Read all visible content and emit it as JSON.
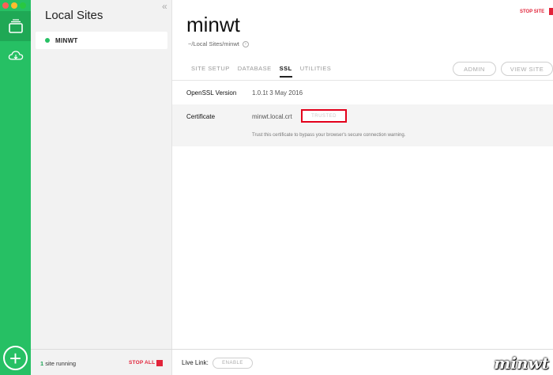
{
  "window": {
    "traffic_colors": [
      "#ff5f57",
      "#febc2e",
      "#28c840"
    ]
  },
  "rail": {
    "icons": [
      "sites-icon",
      "cloud-icon",
      "plus-icon"
    ],
    "add_label": "+"
  },
  "sites_panel": {
    "collapse_glyph": "«",
    "title": "Local Sites",
    "items": [
      {
        "name": "MINWT",
        "status_color": "#26c064"
      }
    ],
    "footer": {
      "running_count": "1",
      "running_text": " site running",
      "stop_all": "STOP ALL"
    }
  },
  "main": {
    "stop_site": "STOP SITE",
    "site_title": "minwt",
    "site_path": "~/Local Sites/minwt",
    "tabs": [
      {
        "label": "SITE SETUP"
      },
      {
        "label": "DATABASE"
      },
      {
        "label": "SSL"
      },
      {
        "label": "UTILITIES"
      }
    ],
    "active_tab": "SSL",
    "buttons": {
      "admin": "ADMIN",
      "view_site": "VIEW SITE"
    },
    "ssl": {
      "openssl_label": "OpenSSL Version",
      "openssl_value": "1.0.1t  3 May 2016",
      "cert_label": "Certificate",
      "cert_value": "minwt.local.crt",
      "trusted_button": "TRUSTED",
      "hint": "Trust this certificate to bypass your browser's secure connection warning."
    },
    "footer": {
      "live_link_label": "Live Link:",
      "enable_button": "ENABLE"
    }
  },
  "watermark": "minwt",
  "colors": {
    "accent_green": "#26c064",
    "stop_red": "#e2243a",
    "highlight_red": "#e3001b"
  }
}
